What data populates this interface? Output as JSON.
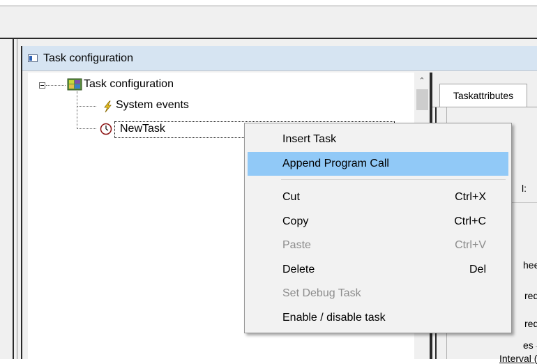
{
  "window": {
    "title": "Task configuration"
  },
  "tree": {
    "root_label": "Task configuration",
    "children": [
      {
        "label": "System events",
        "icon": "lightning-icon"
      },
      {
        "label": "NewTask",
        "icon": "clock-icon"
      }
    ]
  },
  "right_pane": {
    "tab_label": "Taskattributes",
    "fragments": {
      "colon": "l:",
      "wheel": "heelir",
      "red1": "red b",
      "red2": "red b",
      "es": "es",
      "interval": "Interval (e.g"
    }
  },
  "context_menu": {
    "items": [
      {
        "label": "Insert Task",
        "shortcut": "",
        "enabled": true,
        "highlighted": false
      },
      {
        "label": "Append Program Call",
        "shortcut": "",
        "enabled": true,
        "highlighted": true
      },
      {
        "label": "Cut",
        "shortcut": "Ctrl+X",
        "enabled": true,
        "highlighted": false
      },
      {
        "label": "Copy",
        "shortcut": "Ctrl+C",
        "enabled": true,
        "highlighted": false
      },
      {
        "label": "Paste",
        "shortcut": "Ctrl+V",
        "enabled": false,
        "highlighted": false
      },
      {
        "label": "Delete",
        "shortcut": "Del",
        "enabled": true,
        "highlighted": false
      },
      {
        "label": "Set Debug Task",
        "shortcut": "",
        "enabled": false,
        "highlighted": false
      },
      {
        "label": "Enable / disable task",
        "shortcut": "",
        "enabled": true,
        "highlighted": false
      }
    ]
  },
  "colors": {
    "highlight": "#91c9f7",
    "titlebar": "#d6e4f2",
    "disabled_text": "#8c8c8c"
  }
}
